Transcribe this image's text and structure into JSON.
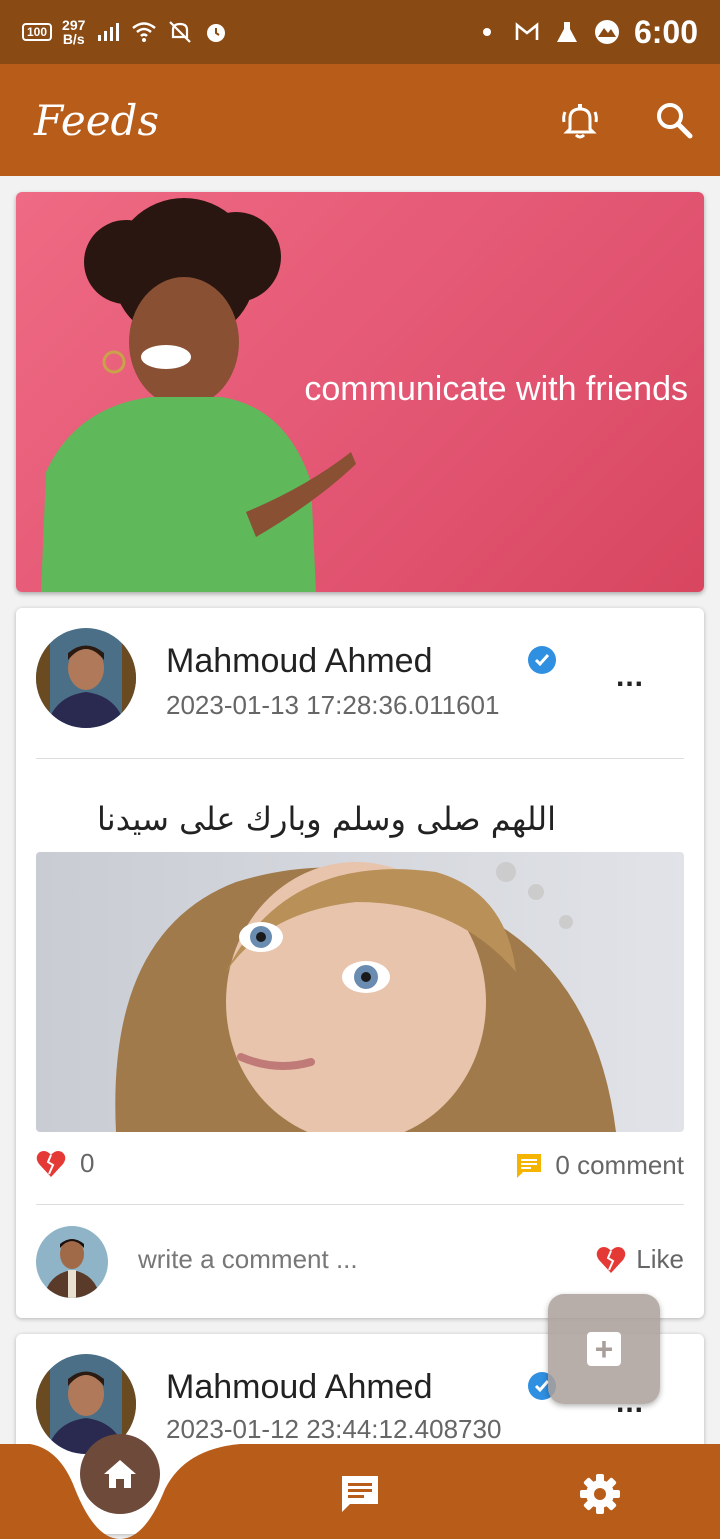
{
  "status_bar": {
    "battery": "100",
    "net_speed_value": "297",
    "net_speed_unit": "B/s",
    "time": "6:00",
    "icons": [
      "signal-icon",
      "wifi-icon",
      "bell-off-icon",
      "alarm-icon",
      "dot-icon",
      "gmail-icon",
      "flask-icon",
      "mountain-app-icon"
    ]
  },
  "app_bar": {
    "title": "Feeds",
    "actions": [
      "notification-bell-icon",
      "search-icon"
    ]
  },
  "banner": {
    "text": "communicate with friends"
  },
  "posts": [
    {
      "author": "Mahmoud Ahmed",
      "verified": true,
      "timestamp": "2023-01-13 17:28:36.011601",
      "more": "...",
      "text": "اللهم صلى وسلم وبارك على سيدنا محمد",
      "likes": "0",
      "comments": "0 comment",
      "comment_placeholder": "write a comment ...",
      "like_label": "Like"
    },
    {
      "author": "Mahmoud Ahmed",
      "verified": true,
      "timestamp": "2023-01-12 23:44:12.408730",
      "more": "..."
    }
  ],
  "fab": {
    "icon": "add-icon"
  },
  "bottom_nav": {
    "items": [
      "home-icon",
      "chat-icon",
      "settings-icon"
    ],
    "active": "home-icon"
  },
  "colors": {
    "status_bar": "#8a4a14",
    "primary": "#b85c1a",
    "banner": "#e85a78",
    "verified": "#2f8fe0",
    "like": "#e53935",
    "comment": "#f4b400",
    "home_active": "#6d4a3a"
  }
}
